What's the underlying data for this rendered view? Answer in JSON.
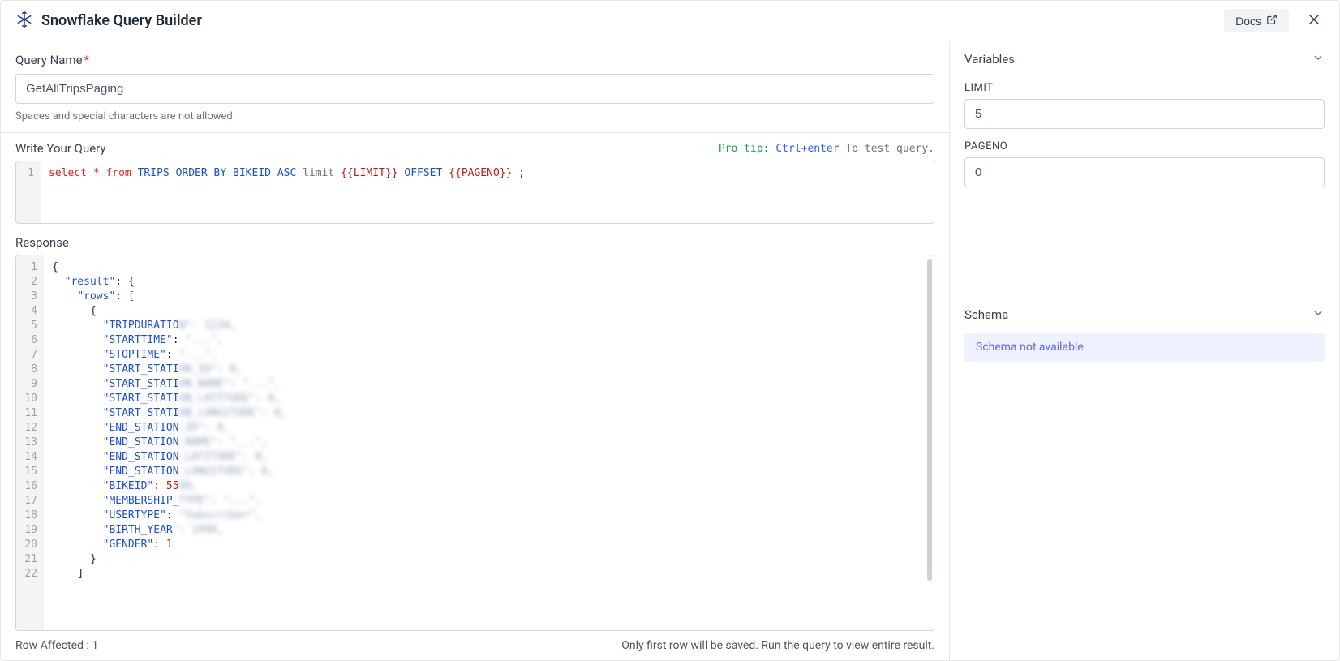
{
  "app": {
    "title": "Snowflake Query Builder",
    "docs_label": "Docs"
  },
  "query_name": {
    "label": "Query Name",
    "value": "GetAllTripsPaging",
    "helper": "Spaces and special characters are not allowed."
  },
  "query_editor": {
    "label": "Write Your Query",
    "pro_tip_prefix": "Pro tip:",
    "pro_tip_shortcut": "Ctrl+enter",
    "pro_tip_suffix": "To test query.",
    "tokens": {
      "select": "select",
      "star": "*",
      "from": "from",
      "table": "TRIPS",
      "order_by": "ORDER BY",
      "col": "BIKEID",
      "dir": "ASC",
      "limit": "limit",
      "var_limit": "{{LIMIT}}",
      "offset": "OFFSET",
      "var_pageno": "{{PAGENO}}",
      "semi": ";"
    },
    "line_no": "1"
  },
  "response": {
    "label": "Response",
    "line_numbers": [
      "1",
      "2",
      "3",
      "4",
      "5",
      "6",
      "7",
      "8",
      "9",
      "10",
      "11",
      "12",
      "13",
      "14",
      "15",
      "16",
      "17",
      "18",
      "19",
      "20",
      "21",
      "22"
    ],
    "lines": [
      {
        "indent": 0,
        "type": "brace",
        "text": "{"
      },
      {
        "indent": 1,
        "type": "kv_brace",
        "key": "result",
        "brace": "{"
      },
      {
        "indent": 2,
        "type": "kv_bracket",
        "key": "rows",
        "bracket": "["
      },
      {
        "indent": 3,
        "type": "brace",
        "text": "{"
      },
      {
        "indent": 4,
        "type": "kv_blur",
        "key": "TRIPDURATIO",
        "blur": "N\": 1234,"
      },
      {
        "indent": 4,
        "type": "kv_blur",
        "key": "STARTTIME",
        "suffix": ":",
        "blur": " \"...\","
      },
      {
        "indent": 4,
        "type": "kv_blur",
        "key": "STOPTIME",
        "suffix": ":",
        "blur": " \"...\","
      },
      {
        "indent": 4,
        "type": "kv_blur",
        "key": "START_STATI",
        "blur": "ON_ID\": 0,"
      },
      {
        "indent": 4,
        "type": "kv_blur",
        "key": "START_STATI",
        "blur": "ON_NAME\": \"...\","
      },
      {
        "indent": 4,
        "type": "kv_blur",
        "key": "START_STATI",
        "blur": "ON_LATITUDE\": 0,"
      },
      {
        "indent": 4,
        "type": "kv_blur",
        "key": "START_STATI",
        "blur": "ON_LONGITUDE\": 0,"
      },
      {
        "indent": 4,
        "type": "kv_blur",
        "key": "END_STATION",
        "blur": "_ID\": 0,"
      },
      {
        "indent": 4,
        "type": "kv_blur",
        "key": "END_STATION",
        "blur": "_NAME\": \"...\","
      },
      {
        "indent": 4,
        "type": "kv_blur",
        "key": "END_STATION",
        "blur": "_LATITUDE\": 0,"
      },
      {
        "indent": 4,
        "type": "kv_blur",
        "key": "END_STATION",
        "blur": "_LONGITUDE\": 0,"
      },
      {
        "indent": 4,
        "type": "kv_num_blur",
        "key": "BIKEID",
        "num": "55",
        "blur": "00,"
      },
      {
        "indent": 4,
        "type": "kv_blur",
        "key": "MEMBERSHIP_",
        "blur": "TYPE\": \"...\","
      },
      {
        "indent": 4,
        "type": "kv_blur",
        "key": "USERTYPE",
        "suffix": ":",
        "blur": " \"Subscriber\","
      },
      {
        "indent": 4,
        "type": "kv_blur",
        "key": "BIRTH_YEAR",
        "blur": "\": 1990,"
      },
      {
        "indent": 4,
        "type": "kv_num",
        "key": "GENDER",
        "num": "1"
      },
      {
        "indent": 3,
        "type": "brace",
        "text": "}"
      },
      {
        "indent": 2,
        "type": "bracket",
        "text": "]"
      }
    ]
  },
  "footer": {
    "row_affected": "Row Affected : 1",
    "hint": "Only first row will be saved. Run the query to view entire result."
  },
  "sidebar": {
    "variables_label": "Variables",
    "limit_label": "LIMIT",
    "limit_value": "5",
    "pageno_label": "PAGENO",
    "pageno_value": "0",
    "schema_label": "Schema",
    "schema_banner": "Schema not available"
  }
}
